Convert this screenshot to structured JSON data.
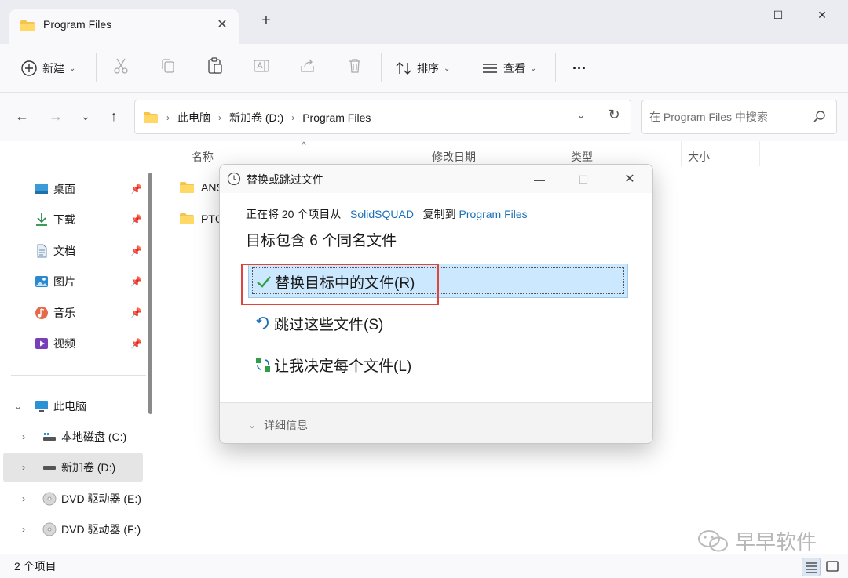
{
  "window": {
    "tab_title": "Program Files",
    "tab_close": "✕",
    "new_tab": "+",
    "minimize": "—",
    "maximize": "☐",
    "close": "✕"
  },
  "toolbar": {
    "new_label": "新建",
    "sort_label": "排序",
    "view_label": "查看",
    "more_label": "···"
  },
  "address": {
    "crumbs": [
      "此电脑",
      "新加卷 (D:)",
      "Program Files"
    ],
    "separator": "›"
  },
  "search": {
    "placeholder": "在 Program Files 中搜索"
  },
  "sidebar": {
    "quick_access": [
      {
        "label": "桌面",
        "icon": "desktop-icon"
      },
      {
        "label": "下载",
        "icon": "download-icon"
      },
      {
        "label": "文档",
        "icon": "document-icon"
      },
      {
        "label": "图片",
        "icon": "pictures-icon"
      },
      {
        "label": "音乐",
        "icon": "music-icon"
      },
      {
        "label": "视频",
        "icon": "video-icon"
      }
    ],
    "this_pc": "此电脑",
    "drives": [
      {
        "label": "本地磁盘 (C:)",
        "icon": "drive-icon"
      },
      {
        "label": "新加卷 (D:)",
        "icon": "drive-icon",
        "selected": true
      },
      {
        "label": "DVD 驱动器 (E:)",
        "icon": "dvd-icon"
      },
      {
        "label": "DVD 驱动器 (F:)",
        "icon": "dvd-icon"
      }
    ]
  },
  "columns": [
    "名称",
    "修改日期",
    "类型",
    "大小"
  ],
  "files": [
    "ANS",
    "PTC"
  ],
  "status": {
    "item_count": "2 个项目"
  },
  "dialog": {
    "title": "替换或跳过文件",
    "line1_prefix": "正在将 20 个项目从 ",
    "source": "_SolidSQUAD_",
    "line1_middle": " 复制到 ",
    "destination": "Program Files",
    "line2": "目标包含 6 个同名文件",
    "options": [
      {
        "label": "替换目标中的文件(R)",
        "icon": "checkmark-icon"
      },
      {
        "label": "跳过这些文件(S)",
        "icon": "undo-arrow-icon"
      },
      {
        "label": "让我决定每个文件(L)",
        "icon": "decide-each-icon"
      }
    ],
    "more_details": "详细信息"
  },
  "watermark": "早早软件",
  "colors": {
    "accent_link": "#1a6fb9",
    "highlight": "#cce8ff",
    "annotation_red": "#e0453d"
  }
}
